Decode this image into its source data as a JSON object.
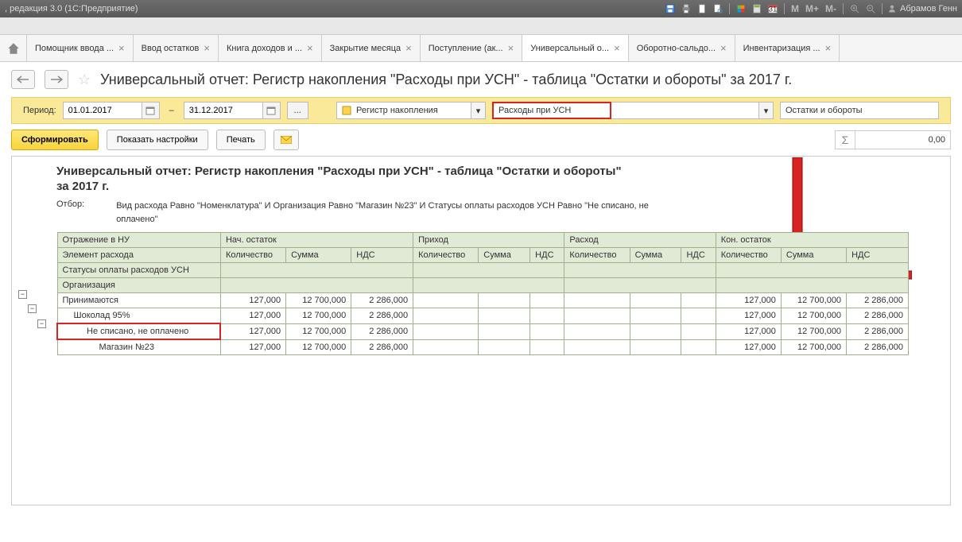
{
  "titlebar": {
    "title": ", редакция 3.0  (1С:Предприятие)",
    "m": "M",
    "mplus": "M+",
    "mminus": "M-",
    "user": "Абрамов Генн"
  },
  "tabs": [
    {
      "label": "Помощник ввода ..."
    },
    {
      "label": "Ввод остатков"
    },
    {
      "label": "Книга доходов и ..."
    },
    {
      "label": "Закрытие месяца"
    },
    {
      "label": "Поступление (ак..."
    },
    {
      "label": "Универсальный о...",
      "active": true
    },
    {
      "label": "Оборотно-сальдо..."
    },
    {
      "label": "Инвентаризация ..."
    }
  ],
  "page_title": "Универсальный отчет: Регистр накопления \"Расходы при УСН\" - таблица \"Остатки и обороты\" за 2017 г.",
  "period": {
    "label": "Период:",
    "from": "01.01.2017",
    "to": "31.12.2017"
  },
  "combo1": "Регистр накопления",
  "combo2": "Расходы при УСН",
  "combo3": "Остатки и обороты",
  "actions": {
    "generate": "Сформировать",
    "settings": "Показать настройки",
    "print": "Печать"
  },
  "sum": "0,00",
  "report": {
    "title": "Универсальный отчет: Регистр накопления \"Расходы при УСН\" - таблица \"Остатки и обороты\"",
    "subtitle": "за 2017 г.",
    "filter_label": "Отбор:",
    "filter_text": "Вид расхода Равно \"Номенклатура\" И Организация Равно \"Магазин №23\" И Статусы оплаты расходов УСН Равно \"Не списано, не оплачено\"",
    "header_groups": [
      "Отражение в НУ",
      "Нач. остаток",
      "Приход",
      "Расход",
      "Кон. остаток"
    ],
    "row_headers": [
      "Элемент расхода",
      "Статусы оплаты расходов УСН",
      "Организация"
    ],
    "sub_cols": [
      "Количество",
      "Сумма",
      "НДС"
    ],
    "rows": [
      {
        "label": "Принимаются",
        "pad": 0,
        "nq": "127,000",
        "ns": "12 700,000",
        "nn": "2 286,000",
        "kq": "127,000",
        "ks": "12 700,000",
        "kn": "2 286,000"
      },
      {
        "label": "Шоколад 95%",
        "pad": 1,
        "nq": "127,000",
        "ns": "12 700,000",
        "nn": "2 286,000",
        "kq": "127,000",
        "ks": "12 700,000",
        "kn": "2 286,000"
      },
      {
        "label": "Не списано, не оплачено",
        "pad": 2,
        "hl": true,
        "nq": "127,000",
        "ns": "12 700,000",
        "nn": "2 286,000",
        "kq": "127,000",
        "ks": "12 700,000",
        "kn": "2 286,000"
      },
      {
        "label": "Магазин №23",
        "pad": 3,
        "nq": "127,000",
        "ns": "12 700,000",
        "nn": "2 286,000",
        "kq": "127,000",
        "ks": "12 700,000",
        "kn": "2 286,000"
      }
    ]
  }
}
